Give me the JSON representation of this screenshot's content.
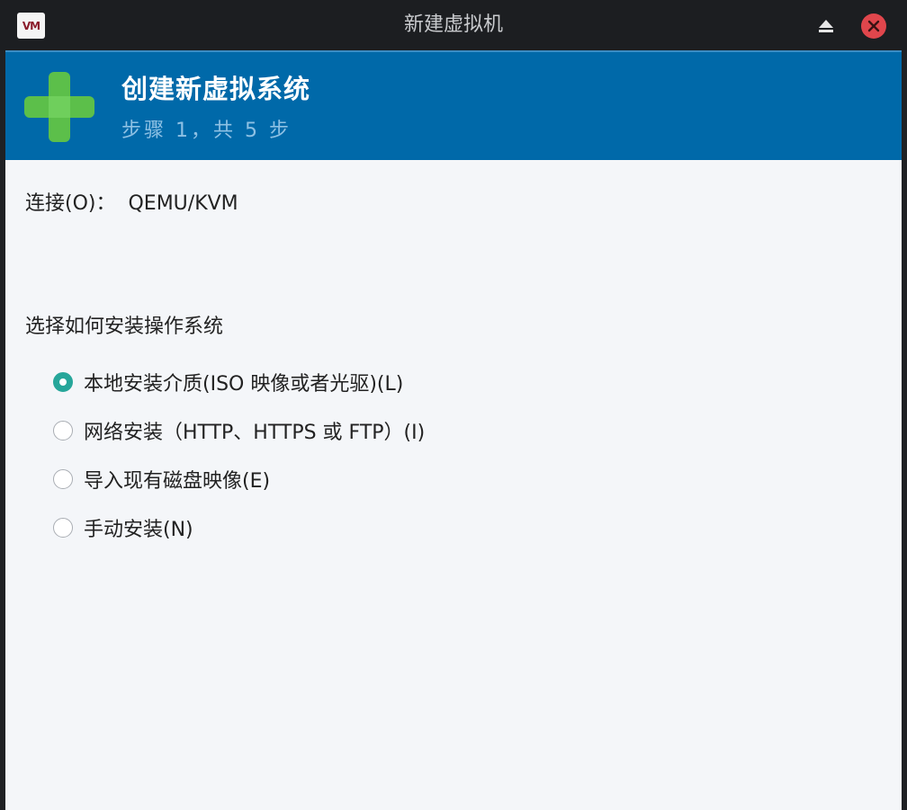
{
  "window": {
    "title": "新建虚拟机",
    "app_icon_text": "VM"
  },
  "banner": {
    "title": "创建新虚拟系统",
    "step": "步骤 1，共 5 步"
  },
  "connection": {
    "label": "连接(O)：",
    "value": "QEMU/KVM"
  },
  "install": {
    "section_title": "选择如何安装操作系统",
    "options": [
      {
        "label": "本地安装介质(ISO 映像或者光驱)(L)",
        "checked": true
      },
      {
        "label": "网络安装（HTTP、HTTPS 或 FTP）(I)",
        "checked": false
      },
      {
        "label": "导入现有磁盘映像(E)",
        "checked": false
      },
      {
        "label": "手动安装(N)",
        "checked": false
      }
    ]
  },
  "colors": {
    "banner": "#0069a9",
    "plus": "#5cbf4a",
    "radio_checked": "#26a69a",
    "close": "#e0464c"
  },
  "icons": [
    "app-icon",
    "eject-icon",
    "close-icon",
    "plus-icon"
  ]
}
